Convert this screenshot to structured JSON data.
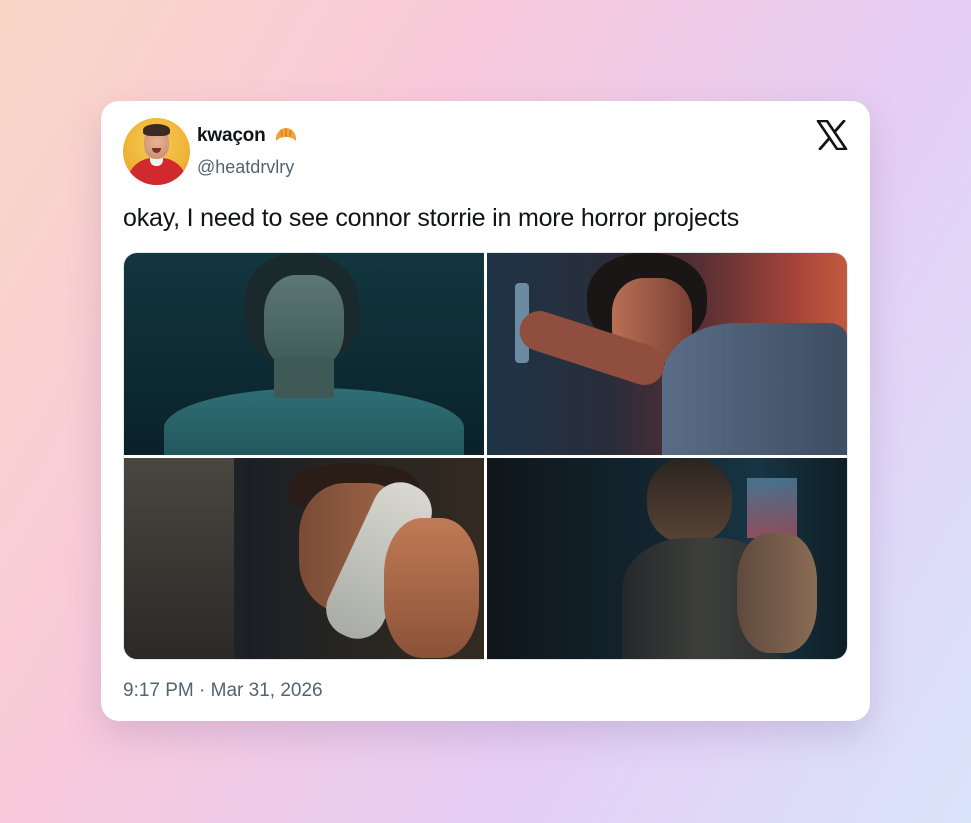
{
  "author": {
    "display_name": "kwaçon",
    "handle": "@heatdrvlry",
    "name_emoji_icon": "croissant-icon",
    "avatar_icon": "avatar"
  },
  "platform_logo_icon": "x-logo-icon",
  "tweet": {
    "text": "okay, I need to see connor storrie in more horror projects",
    "media_count": 4,
    "timestamp": "9:17 PM · Mar 31, 2026"
  },
  "colors": {
    "text_primary": "#0f1419",
    "text_secondary": "#536471",
    "card_background": "#ffffff"
  }
}
